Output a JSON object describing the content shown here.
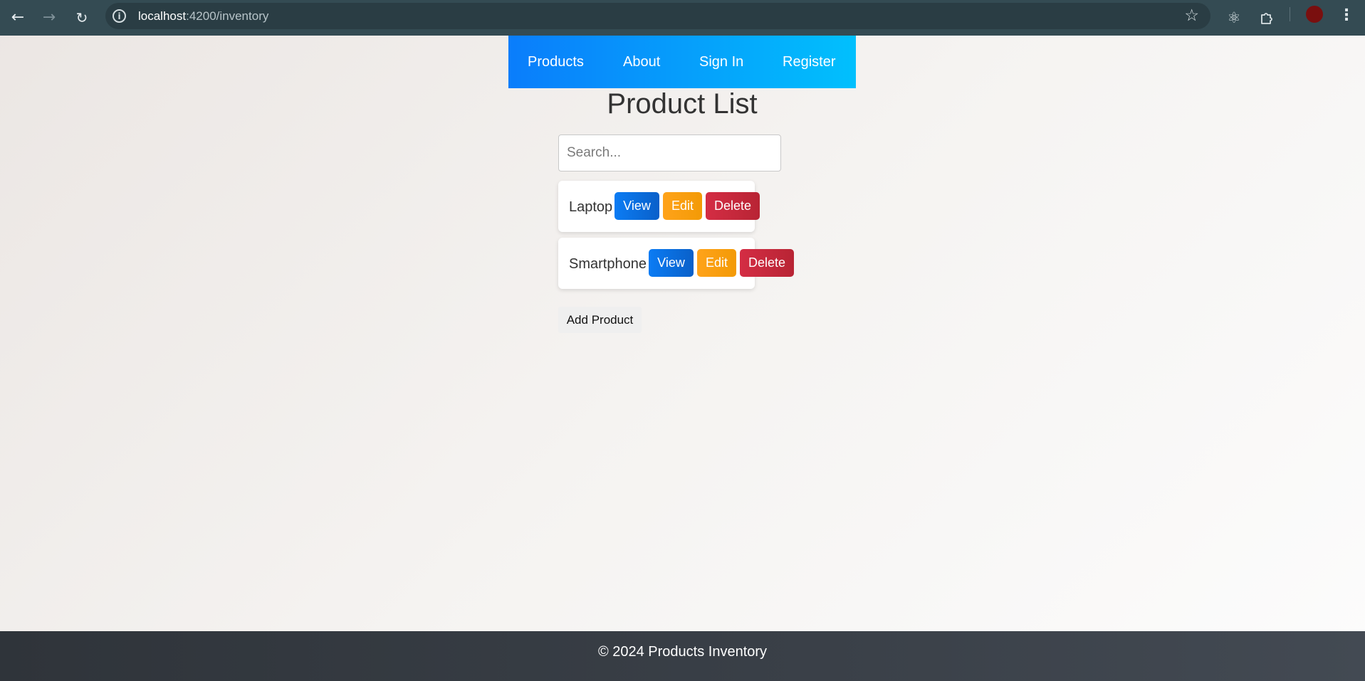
{
  "browser": {
    "url_host": "localhost",
    "url_path": ":4200/inventory",
    "icons": {
      "back": "back-arrow-icon",
      "forward": "forward-arrow-icon",
      "reload": "reload-icon",
      "info": "site-info-icon",
      "bookmark": "bookmark-star-icon",
      "react_devtools": "react-devtools-icon",
      "extensions": "extensions-puzzle-icon",
      "profile": "profile-avatar",
      "menu": "kebab-menu-icon"
    }
  },
  "navbar": {
    "items": [
      {
        "label": "Products"
      },
      {
        "label": "About"
      },
      {
        "label": "Sign In"
      },
      {
        "label": "Register"
      }
    ]
  },
  "main": {
    "title": "Product List",
    "search_placeholder": "Search...",
    "products": [
      {
        "name": "Laptop",
        "view": "View",
        "edit": "Edit",
        "delete": "Delete"
      },
      {
        "name": "Smartphone",
        "view": "View",
        "edit": "Edit",
        "delete": "Delete"
      }
    ],
    "add_label": "Add Product"
  },
  "footer": {
    "text": "© 2024 Products Inventory"
  },
  "colors": {
    "nav_gradient_start": "#0a7dfb",
    "nav_gradient_end": "#01c0fd",
    "view_button": "#0a6fe0",
    "edit_button": "#f79f0e",
    "delete_button": "#c5283c",
    "footer_bg": "#3a4048"
  }
}
